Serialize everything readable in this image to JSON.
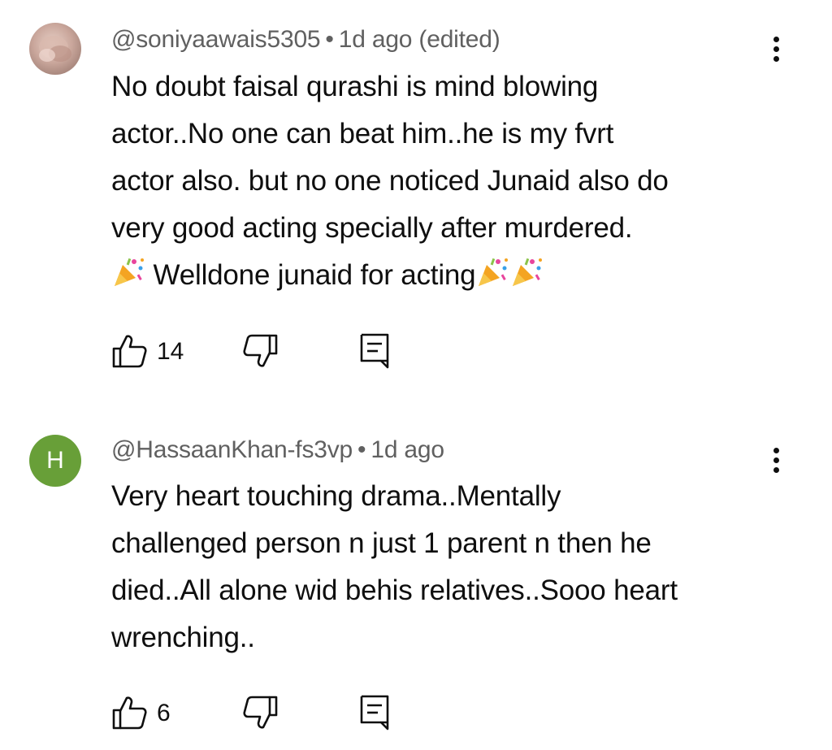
{
  "comments": [
    {
      "handle": "@soniyaawais5305",
      "separator": "•",
      "time": "1d ago (edited)",
      "avatar": {
        "type": "photo",
        "letter": ""
      },
      "lines": [
        "No doubt faisal qurashi is mind blowing",
        "actor..No one can beat him..he is my fvrt",
        "actor also. but no one noticed Junaid also do",
        "very good acting specially after murdered."
      ],
      "last_line_text": " Welldone junaid for acting",
      "likes": "14"
    },
    {
      "handle": "@HassaanKhan-fs3vp",
      "separator": "•",
      "time": "1d ago",
      "avatar": {
        "type": "letter",
        "letter": "H"
      },
      "lines": [
        "Very heart touching drama..Mentally",
        "challenged person n just 1 parent n then he",
        "died..All alone wid behis relatives..Sooo heart",
        "wrenching.."
      ],
      "likes": "6"
    }
  ],
  "icons": {
    "like": "thumb-up-icon",
    "dislike": "thumb-down-icon",
    "reply": "reply-comment-icon",
    "more": "more-vertical-icon",
    "emoji": "party-popper-emoji"
  },
  "colors": {
    "avatar_letter_bg": "#689f38",
    "meta_text": "#606060",
    "body_text": "#0f0f0f"
  }
}
